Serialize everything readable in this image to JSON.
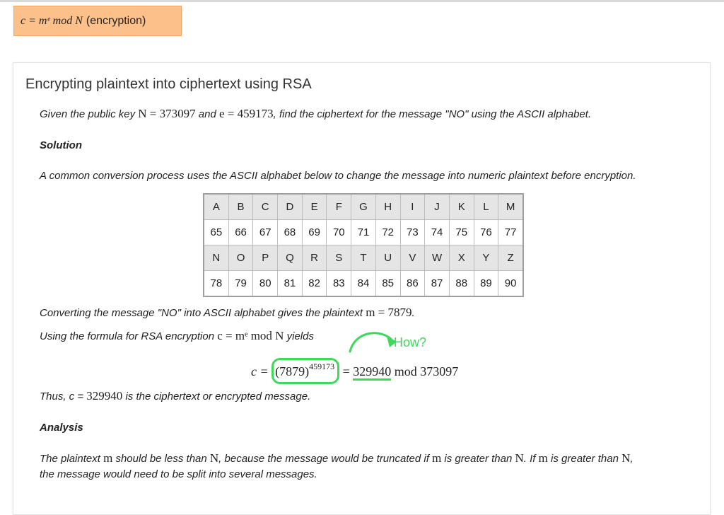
{
  "formula_tag": {
    "math": "c = mᵉ mod N",
    "label": "(encryption)"
  },
  "card": {
    "title": "Encrypting plaintext into ciphertext using RSA",
    "problem": {
      "prefix": "Given the public key ",
      "n_symbol": "N",
      "eq1": " = 373097",
      "mid": " and ",
      "e_symbol": "e",
      "eq2": " = 459173",
      "suffix": ", find the ciphertext for the message \"NO\" using the ASCII alphabet."
    },
    "solution_heading": "Solution",
    "conversion_text": "A common conversion process uses the ASCII alphabet below to change the message into numeric plaintext before encryption.",
    "ascii_table": {
      "rows": [
        [
          "A",
          "B",
          "C",
          "D",
          "E",
          "F",
          "G",
          "H",
          "I",
          "J",
          "K",
          "L",
          "M"
        ],
        [
          "65",
          "66",
          "67",
          "68",
          "69",
          "70",
          "71",
          "72",
          "73",
          "74",
          "75",
          "76",
          "77"
        ],
        [
          "N",
          "O",
          "P",
          "Q",
          "R",
          "S",
          "T",
          "U",
          "V",
          "W",
          "X",
          "Y",
          "Z"
        ],
        [
          "78",
          "79",
          "80",
          "81",
          "82",
          "83",
          "84",
          "85",
          "86",
          "87",
          "88",
          "89",
          "90"
        ]
      ]
    },
    "converting": {
      "prefix": "Converting the message \"NO\" into ASCII alphabet gives the plaintext ",
      "m_symbol": "m",
      "eq": " = 7879",
      "suffix": "."
    },
    "using": {
      "prefix": "Using the formula for RSA encryption ",
      "math": "c = mᵉ mod N",
      "suffix": " yields"
    },
    "equation": {
      "lhs": "c = ",
      "base": "(7879)",
      "exponent": "459173",
      "eq": " = ",
      "result": "329940",
      "mod_text": " mod 373097"
    },
    "annotation": "How?",
    "thus": {
      "prefix": "Thus, c = ",
      "value": "329940",
      "suffix": " is the ciphertext or encrypted message."
    },
    "analysis_heading": "Analysis",
    "analysis_line1": {
      "a": "The plaintext ",
      "m1": "m",
      "b": " should be less than ",
      "n1": "N",
      "c": ", because the message would be truncated if ",
      "m2": "m",
      "d": " is greater than ",
      "n2": "N",
      "e": ". If ",
      "m3": "m",
      "f": " is greater than ",
      "n3": "N",
      "g": ","
    },
    "analysis_line2": "the message would need to be split into several messages."
  },
  "colors": {
    "tag_background": "#fcc08a",
    "annotation_green": "#3fd85a",
    "table_header_gray": "#e5e5e5"
  }
}
